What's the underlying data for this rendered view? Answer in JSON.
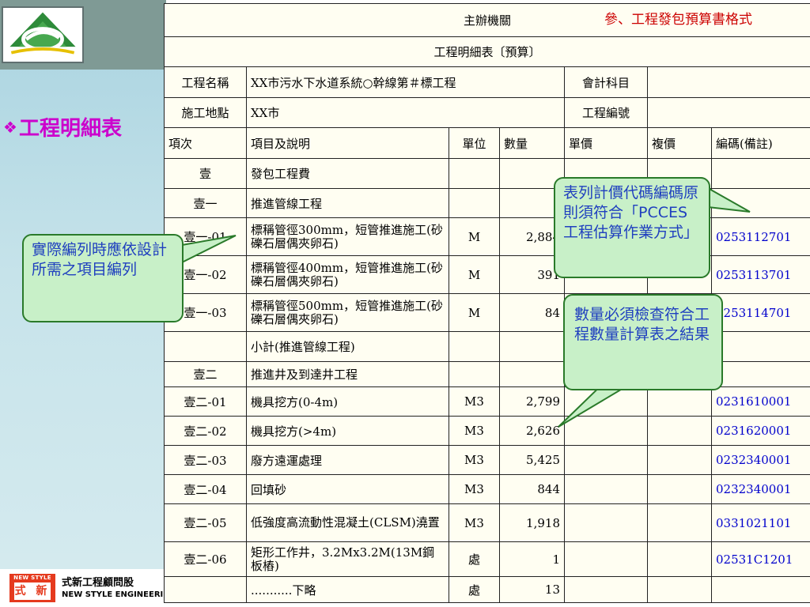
{
  "doc_title": "參、工程發包預算書格式",
  "section_title": "工程明細表",
  "brand": {
    "box_small": "NEW STYLE",
    "box_big": "式 新",
    "name_cn": "式新工程顧問股",
    "name_en": "NEW STYLE ENGINEERING"
  },
  "table": {
    "agency": "主辦機關",
    "title": "工程明細表〔預算〕",
    "project_name_label": "工程名稱",
    "project_name": "XX市污水下水道系統○幹線第＃標工程",
    "account_label": "會計科目",
    "site_label": "施工地點",
    "site": "XX市",
    "project_no_label": "工程編號",
    "headers": [
      "項次",
      "項目及說明",
      "單位",
      "數量",
      "單價",
      "複價",
      "編碼(備註)"
    ],
    "rows": [
      {
        "item": "壹",
        "desc": "發包工程費",
        "unit": "",
        "qty": "",
        "price": "",
        "total": "",
        "code": ""
      },
      {
        "item": "壹一",
        "desc": "推進管線工程",
        "unit": "",
        "qty": "",
        "price": "",
        "total": "",
        "code": ""
      },
      {
        "item": "壹一-01",
        "desc": "標稱管徑300mm，短管推進施工(砂礫石層偶夾卵石)",
        "unit": "M",
        "qty": "2,884",
        "price": "",
        "total": "",
        "code": "0253112701"
      },
      {
        "item": "壹一-02",
        "desc": "標稱管徑400mm，短管推進施工(砂礫石層偶夾卵石)",
        "unit": "M",
        "qty": "391",
        "price": "",
        "total": "",
        "code": "0253113701"
      },
      {
        "item": "壹一-03",
        "desc": "標稱管徑500mm，短管推進施工(砂礫石層偶夾卵石)",
        "unit": "M",
        "qty": "84",
        "price": "",
        "total": "",
        "code": "0253114701"
      },
      {
        "item": "",
        "desc": "小計(推進管線工程)",
        "unit": "",
        "qty": "",
        "price": "",
        "total": "",
        "code": ""
      },
      {
        "item": "壹二",
        "desc": "推進井及到達井工程",
        "unit": "",
        "qty": "",
        "price": "",
        "total": "",
        "code": ""
      },
      {
        "item": "壹二-01",
        "desc": "機具挖方(0-4m)",
        "unit": "M3",
        "qty": "2,799",
        "price": "",
        "total": "",
        "code": "0231610001"
      },
      {
        "item": "壹二-02",
        "desc": "機具挖方(>4m)",
        "unit": "M3",
        "qty": "2,626",
        "price": "",
        "total": "",
        "code": "0231620001"
      },
      {
        "item": "壹二-03",
        "desc": "廢方遠運處理",
        "unit": "M3",
        "qty": "5,425",
        "price": "",
        "total": "",
        "code": "0232340001"
      },
      {
        "item": "壹二-04",
        "desc": "回填砂",
        "unit": "M3",
        "qty": "844",
        "price": "",
        "total": "",
        "code": "0232340001"
      },
      {
        "item": "壹二-05",
        "desc": "低強度高流動性混凝土(CLSM)澆置",
        "unit": "M3",
        "qty": "1,918",
        "price": "",
        "total": "",
        "code": "0331021101"
      },
      {
        "item": "壹二-06",
        "desc": "矩形工作井，3.2Mx3.2M(13M鋼板樁)",
        "unit": "處",
        "qty": "1",
        "price": "",
        "total": "",
        "code": "02531C1201"
      },
      {
        "item": "",
        "desc": "...........下略",
        "unit": "處",
        "qty": "13",
        "price": "",
        "total": "",
        "code": ""
      }
    ]
  },
  "callouts": {
    "left": "實際編列時應依設計所需之項目編列",
    "top_right": "表列計價代碼編碼原則須符合「PCCES工程估算作業方式」",
    "mid_right": "數量必須檢查符合工程數量計算表之結果"
  },
  "colors": {
    "callout_fill": "#c8f0c8",
    "callout_text": "#1f3fbf",
    "code_text": "#0000cc",
    "title_red": "#cc0000",
    "section_magenta": "#cc00cc"
  }
}
